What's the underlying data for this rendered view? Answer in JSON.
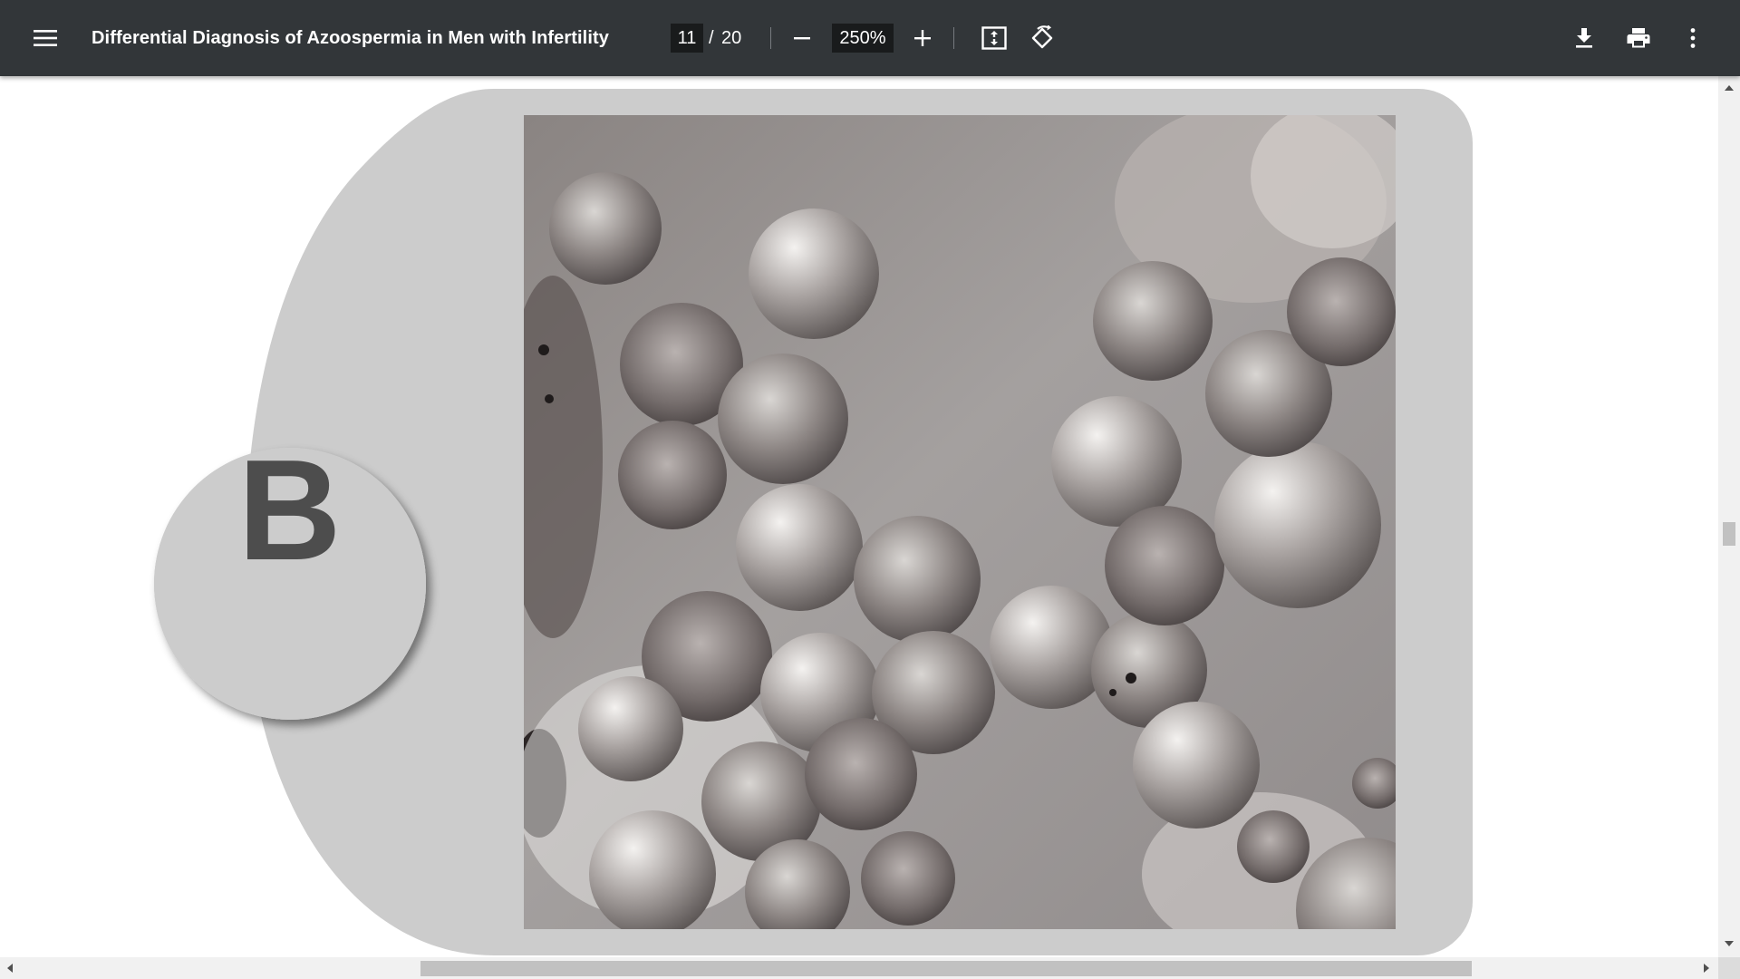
{
  "toolbar": {
    "menu_icon": "hamburger-menu-icon",
    "title": "Differential Diagnosis of Azoospermia in Men with Infertility",
    "page_current": "11",
    "page_separator": "/",
    "page_total": "20",
    "zoom_out_icon": "minus-icon",
    "zoom_value": "250%",
    "zoom_in_icon": "plus-icon",
    "fit_page_icon": "fit-to-page-icon",
    "rotate_icon": "rotate-counterclockwise-icon",
    "download_icon": "download-icon",
    "print_icon": "print-icon",
    "more_icon": "more-vertical-icon"
  },
  "document": {
    "figure_label": "B"
  },
  "colors": {
    "toolbar_bg": "#323639",
    "input_bg": "#191b1c",
    "page_bg": "#ffffff",
    "frame_gray": "#cccccc",
    "label_text": "#4d4d4d",
    "scrollbar_track": "#f1f1f1",
    "scrollbar_thumb": "#c1c1c1"
  }
}
